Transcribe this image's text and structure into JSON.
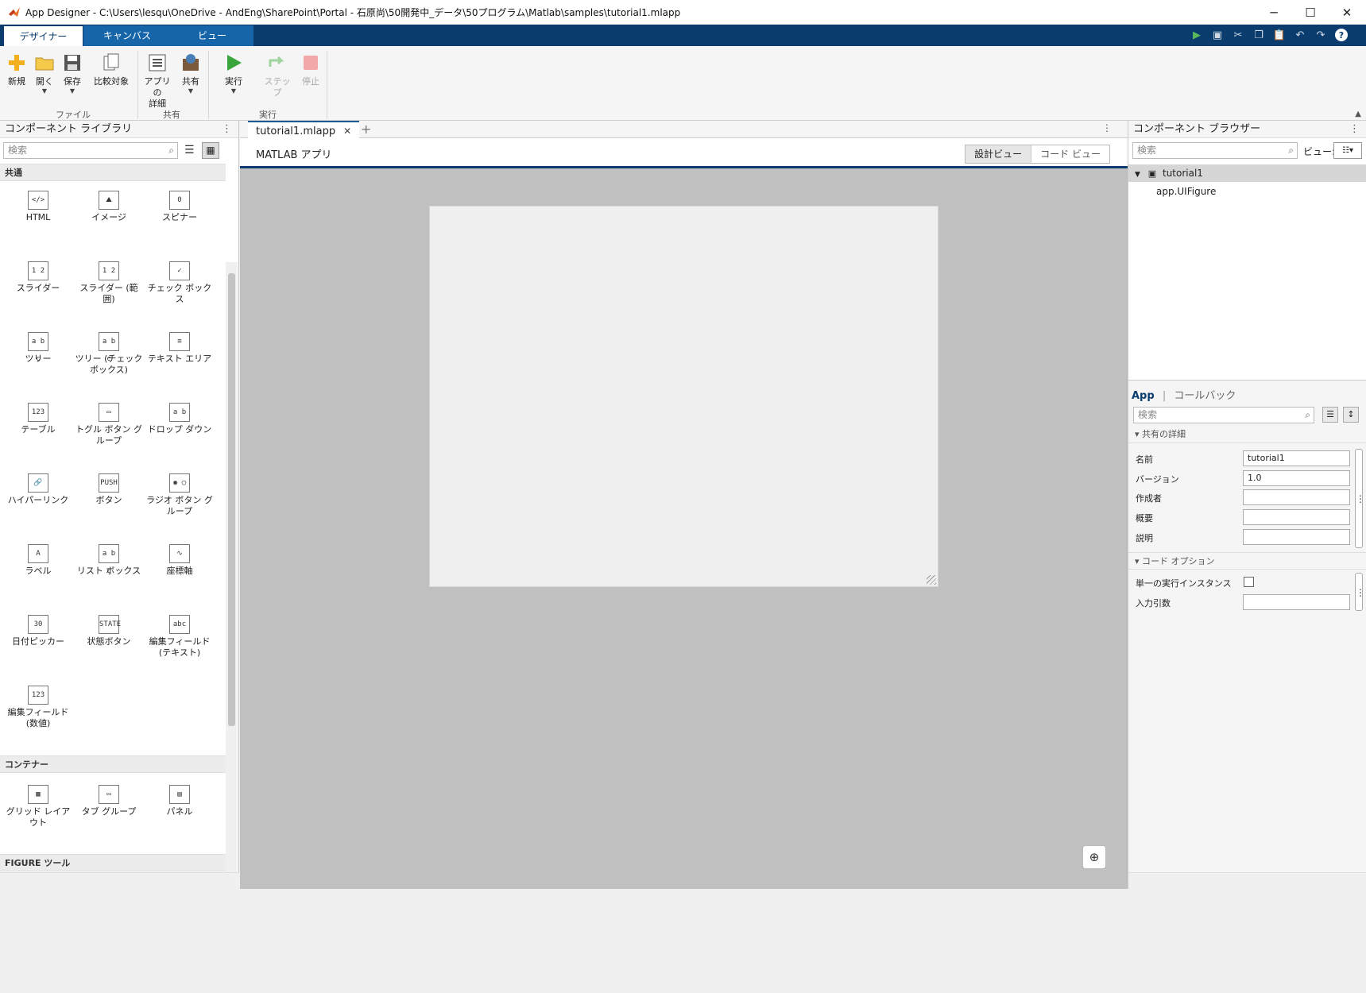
{
  "window": {
    "title": "App Designer - C:\\Users\\lesqu\\OneDrive - AndEng\\SharePoint\\Portal - 石原尚\\50開発中_データ\\50プログラム\\Matlab\\samples\\tutorial1.mlapp",
    "minimize": "─",
    "maximize": "☐",
    "close": "✕"
  },
  "tabs": [
    "デザイナー",
    "キャンバス",
    "ビュー"
  ],
  "ribbon": {
    "groups": [
      "ファイル",
      "共有",
      "実行"
    ],
    "buttons": {
      "new": "新規",
      "open": "開く",
      "save": "保存",
      "compare": "比較対象",
      "app_details": "アプリの\n詳細",
      "share": "共有",
      "run": "実行",
      "step": "ステップ",
      "stop": "停止"
    }
  },
  "library": {
    "title": "コンポーネント ライブラリ",
    "search_placeholder": "検索",
    "sections": [
      "共通",
      "コンテナー",
      "FIGURE ツール"
    ],
    "components": [
      {
        "label": "HTML",
        "glyph": "</>"
      },
      {
        "label": "イメージ",
        "glyph": "⛰"
      },
      {
        "label": "スピナー",
        "glyph": "0"
      },
      {
        "label": "スライダー",
        "glyph": "1 2"
      },
      {
        "label": "スライダー (範囲)",
        "glyph": "1 2"
      },
      {
        "label": "チェック ボックス",
        "glyph": "✓"
      },
      {
        "label": "ツリー",
        "glyph": "a b c"
      },
      {
        "label": "ツリー (チェック ボックス)",
        "glyph": "a b c"
      },
      {
        "label": "テキスト エリア",
        "glyph": "≡"
      },
      {
        "label": "テーブル",
        "glyph": "123"
      },
      {
        "label": "トグル ボタン グループ",
        "glyph": "▭"
      },
      {
        "label": "ドロップ ダウン",
        "glyph": "a b"
      },
      {
        "label": "ハイパーリンク",
        "glyph": "🔗"
      },
      {
        "label": "ボタン",
        "glyph": "PUSH"
      },
      {
        "label": "ラジオ ボタン グループ",
        "glyph": "◉ ◯"
      },
      {
        "label": "ラベル",
        "glyph": "A"
      },
      {
        "label": "リスト ボックス",
        "glyph": "a b c"
      },
      {
        "label": "座標軸",
        "glyph": "∿"
      },
      {
        "label": "日付ピッカー",
        "glyph": "30"
      },
      {
        "label": "状態ボタン",
        "glyph": "STATE"
      },
      {
        "label": "編集フィールド (テキスト)",
        "glyph": "abc"
      },
      {
        "label": "編集フィールド (数値)",
        "glyph": "123"
      }
    ],
    "containers": [
      {
        "label": "グリッド レイアウト",
        "glyph": "▦"
      },
      {
        "label": "タブ グループ",
        "glyph": "▭"
      },
      {
        "label": "パネル",
        "glyph": "▤"
      }
    ]
  },
  "editor": {
    "doc_tab": "tutorial1.mlapp",
    "app_title": "MATLAB アプリ",
    "view_design": "設計ビュー",
    "view_code": "コード ビュー"
  },
  "browser": {
    "title": "コンポーネント ブラウザー",
    "search_placeholder": "検索",
    "view_label": "ビュー:",
    "tree_root": "tutorial1",
    "tree_child": "app.UIFigure"
  },
  "properties": {
    "tab_app": "App",
    "tab_callbacks": "コールバック",
    "search_placeholder": "検索",
    "section_details": "共有の詳細",
    "section_code": "コード オプション",
    "fields": [
      {
        "label": "名前",
        "value": "tutorial1"
      },
      {
        "label": "バージョン",
        "value": "1.0"
      },
      {
        "label": "作成者",
        "value": ""
      },
      {
        "label": "概要",
        "value": ""
      },
      {
        "label": "説明",
        "value": ""
      }
    ],
    "single_instance_label": "単一の実行インスタンス",
    "input_args_label": "入力引数"
  }
}
